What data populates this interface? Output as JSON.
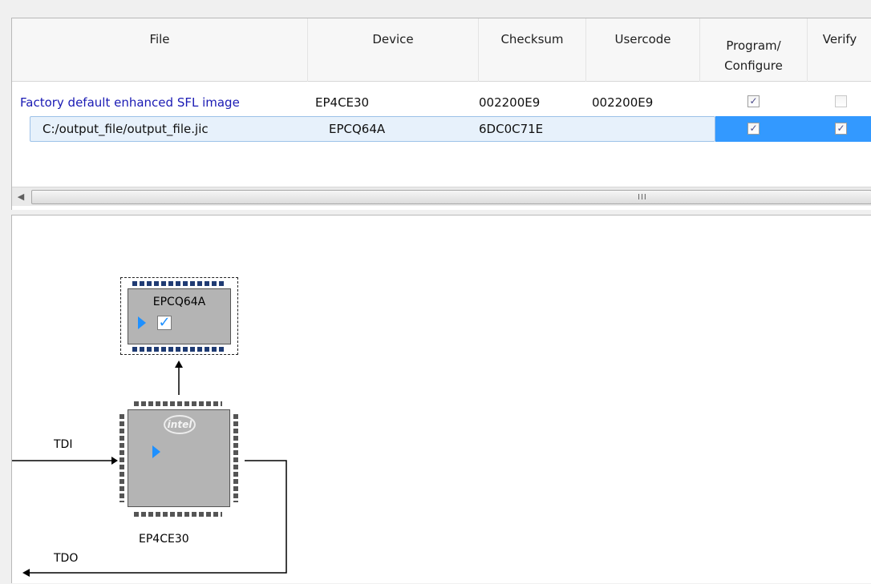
{
  "table": {
    "columns": {
      "file": "File",
      "device": "Device",
      "checksum": "Checksum",
      "usercode": "Usercode",
      "program_line1": "Program/",
      "program_line2": "Configure",
      "verify": "Verify"
    },
    "rows": [
      {
        "file": "Factory default enhanced SFL image",
        "device": "EP4CE30",
        "checksum": "002200E9",
        "usercode": "002200E9",
        "program_configure": true,
        "verify": false
      },
      {
        "file": "C:/output_file/output_file.jic",
        "device": "EPCQ64A",
        "checksum": "6DC0C71E",
        "usercode": "",
        "program_configure": true,
        "verify": true,
        "selected": true
      }
    ],
    "scrollbar": {
      "left_arrow": "◀",
      "grip": "III"
    }
  },
  "chain": {
    "flash_device": "EPCQ64A",
    "fpga_device": "EP4CE30",
    "fpga_logo": "intel",
    "tdi_label": "TDI",
    "tdo_label": "TDO"
  },
  "colors": {
    "selection_blue": "#3399ff",
    "link_blue": "#1a1ab4",
    "chip_gray": "#b4b4b4",
    "accent_blue": "#1e90ff"
  }
}
